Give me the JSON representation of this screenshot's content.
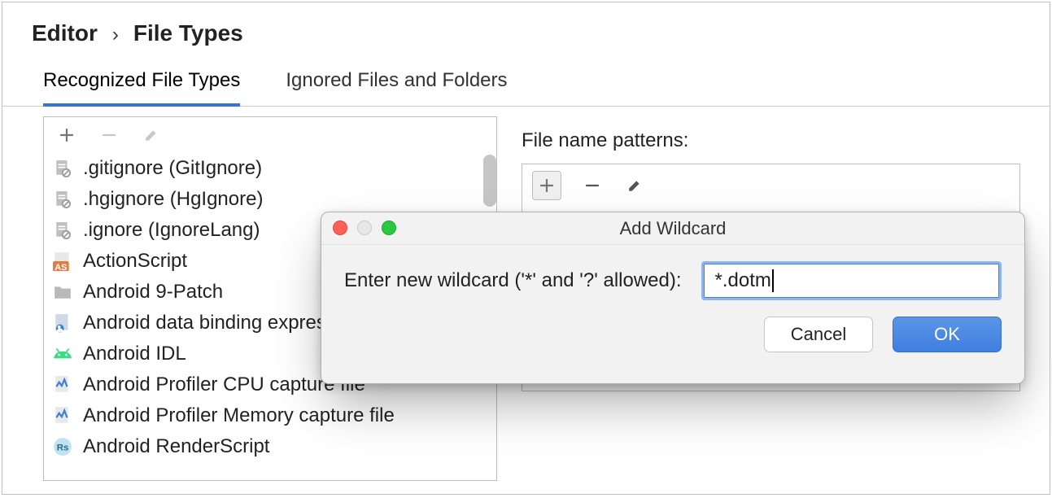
{
  "breadcrumb": {
    "parent": "Editor",
    "current": "File Types",
    "sep": "›"
  },
  "tabs": [
    {
      "label": "Recognized File Types",
      "active": true
    },
    {
      "label": "Ignored Files and Folders",
      "active": false
    }
  ],
  "left_toolbar": {
    "add": "plus-icon",
    "remove": "minus-icon",
    "edit": "pencil-icon"
  },
  "file_types": [
    {
      "icon": "file-ignore-icon",
      "label": ".gitignore (GitIgnore)"
    },
    {
      "icon": "file-ignore-icon",
      "label": ".hgignore (HgIgnore)"
    },
    {
      "icon": "file-ignore-icon",
      "label": ".ignore (IgnoreLang)"
    },
    {
      "icon": "as-icon",
      "label": "ActionScript"
    },
    {
      "icon": "folder-icon",
      "label": "Android 9-Patch"
    },
    {
      "icon": "data-binding-icon",
      "label": "Android data binding expression file"
    },
    {
      "icon": "android-idl-icon",
      "label": "Android IDL"
    },
    {
      "icon": "profiler-cpu-icon",
      "label": "Android Profiler CPU capture file"
    },
    {
      "icon": "profiler-mem-icon",
      "label": "Android Profiler Memory capture file"
    },
    {
      "icon": "rs-icon",
      "label": "Android RenderScript"
    }
  ],
  "right": {
    "title": "File name patterns:"
  },
  "dialog": {
    "title": "Add Wildcard",
    "prompt": "Enter new wildcard ('*' and '?' allowed):",
    "value": "*.dotm",
    "cancel": "Cancel",
    "ok": "OK"
  }
}
